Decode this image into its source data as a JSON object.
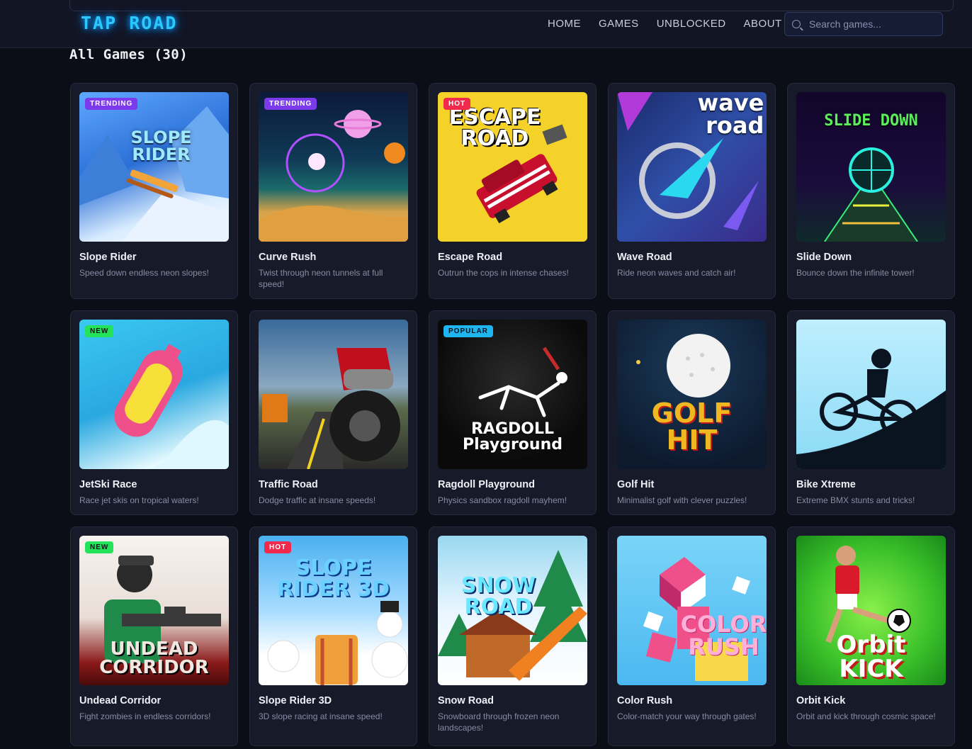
{
  "header": {
    "logo": "TAP ROAD",
    "nav": [
      "HOME",
      "GAMES",
      "UNBLOCKED",
      "ABOUT"
    ],
    "search_placeholder": "Search games..."
  },
  "section_title": "All Games (30)",
  "games": [
    {
      "name": "Slope Rider",
      "desc": "Speed down endless neon slopes!",
      "badge": "TRENDING",
      "art": "SLOPE\nRIDER",
      "icon": "sled-icon"
    },
    {
      "name": "Curve Rush",
      "desc": "Twist through neon tunnels at full speed!",
      "badge": "TRENDING",
      "art": "",
      "icon": "planet-icon"
    },
    {
      "name": "Escape Road",
      "desc": "Outrun the cops in intense chases!",
      "badge": "HOT",
      "art": "ESCAPE\nROAD",
      "icon": "car-icon"
    },
    {
      "name": "Wave Road",
      "desc": "Ride neon waves and catch air!",
      "badge": "",
      "art": "wave\nroad",
      "icon": "arrow-icon"
    },
    {
      "name": "Slide Down",
      "desc": "Bounce down the infinite tower!",
      "badge": "",
      "art": "SLIDE DOWN",
      "icon": "ball-icon"
    },
    {
      "name": "JetSki Race",
      "desc": "Race jet skis on tropical waters!",
      "badge": "NEW",
      "art": "",
      "icon": "jetski-icon"
    },
    {
      "name": "Traffic Road",
      "desc": "Dodge traffic at insane speeds!",
      "badge": "",
      "art": "",
      "icon": "motorcycle-icon"
    },
    {
      "name": "Ragdoll Playground",
      "desc": "Physics sandbox ragdoll mayhem!",
      "badge": "POPULAR",
      "art": "RAGDOLL\nPlayground",
      "icon": "ragdoll-icon"
    },
    {
      "name": "Golf Hit",
      "desc": "Minimalist golf with clever puzzles!",
      "badge": "",
      "art": "GOLF\nHIT",
      "icon": "golf-ball-icon"
    },
    {
      "name": "Bike Xtreme",
      "desc": "Extreme BMX stunts and tricks!",
      "badge": "",
      "art": "",
      "icon": "bike-icon"
    },
    {
      "name": "Undead Corridor",
      "desc": "Fight zombies in endless corridors!",
      "badge": "NEW",
      "art": "UNDEAD\nCORRIDOR",
      "icon": "soldier-icon"
    },
    {
      "name": "Slope Rider 3D",
      "desc": "3D slope racing at insane speed!",
      "badge": "HOT",
      "art": "SLOPE\nRIDER 3D",
      "icon": "snowman-icon"
    },
    {
      "name": "Snow Road",
      "desc": "Snowboard through frozen neon landscapes!",
      "badge": "",
      "art": "SNOW\nROAD",
      "icon": "cabin-icon"
    },
    {
      "name": "Color Rush",
      "desc": "Color-match your way through gates!",
      "badge": "",
      "art": "COLOR\nRUSH",
      "icon": "cube-bird-icon"
    },
    {
      "name": "Orbit Kick",
      "desc": "Orbit and kick through cosmic space!",
      "badge": "",
      "art": "Orbit\nKICK",
      "icon": "soccer-icon"
    }
  ]
}
